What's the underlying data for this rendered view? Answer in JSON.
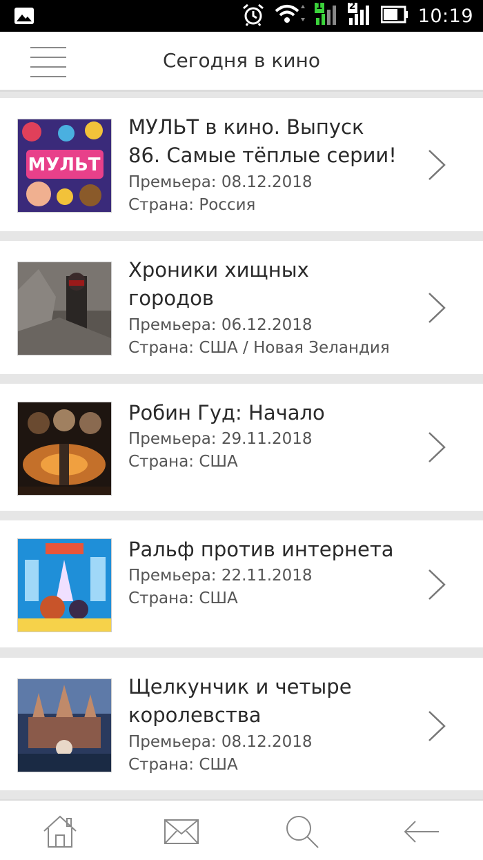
{
  "status_bar": {
    "time": "10:19",
    "sim1_label": "1",
    "sim2_label": "2"
  },
  "header": {
    "title": "Сегодня в кино"
  },
  "movies": [
    {
      "title_line1": "МУЛЬТ в кино. Выпуск",
      "title_line2": "86. Самые тёплые серии!",
      "premiere": "Премьера: 08.12.2018",
      "country": "Страна: Россия"
    },
    {
      "title_line1": "Хроники хищных",
      "title_line2": "городов",
      "premiere": "Премьера: 06.12.2018",
      "country": "Страна: США / Новая Зеландия"
    },
    {
      "title_line1": "Робин Гуд: Начало",
      "title_line2": "",
      "premiere": "Премьера: 29.11.2018",
      "country": "Страна: США"
    },
    {
      "title_line1": "Ральф против интернета",
      "title_line2": "",
      "premiere": "Премьера: 22.11.2018",
      "country": "Страна: США"
    },
    {
      "title_line1": "Щелкунчик и четыре",
      "title_line2": "королевства",
      "premiere": "Премьера: 08.12.2018",
      "country": "Страна: США"
    }
  ],
  "posters": [
    {
      "name": "mult-v-kino-poster",
      "colors": [
        "#3a2a7a",
        "#e0405a",
        "#f2c23a"
      ]
    },
    {
      "name": "mortal-engines-poster",
      "colors": [
        "#5a5550",
        "#8a8580",
        "#2a2624"
      ]
    },
    {
      "name": "robin-hood-poster",
      "colors": [
        "#1e1510",
        "#c4702a",
        "#3a2a20"
      ]
    },
    {
      "name": "ralph-breaks-the-internet-poster",
      "colors": [
        "#1f8fd8",
        "#e8553a",
        "#f6d24a"
      ]
    },
    {
      "name": "nutcracker-poster",
      "colors": [
        "#2a3a5e",
        "#c08a6a",
        "#5e7aa8"
      ]
    }
  ],
  "bottom_nav": {
    "home": "home-icon",
    "mail": "mail-icon",
    "search": "search-icon",
    "back": "back-arrow-icon"
  }
}
